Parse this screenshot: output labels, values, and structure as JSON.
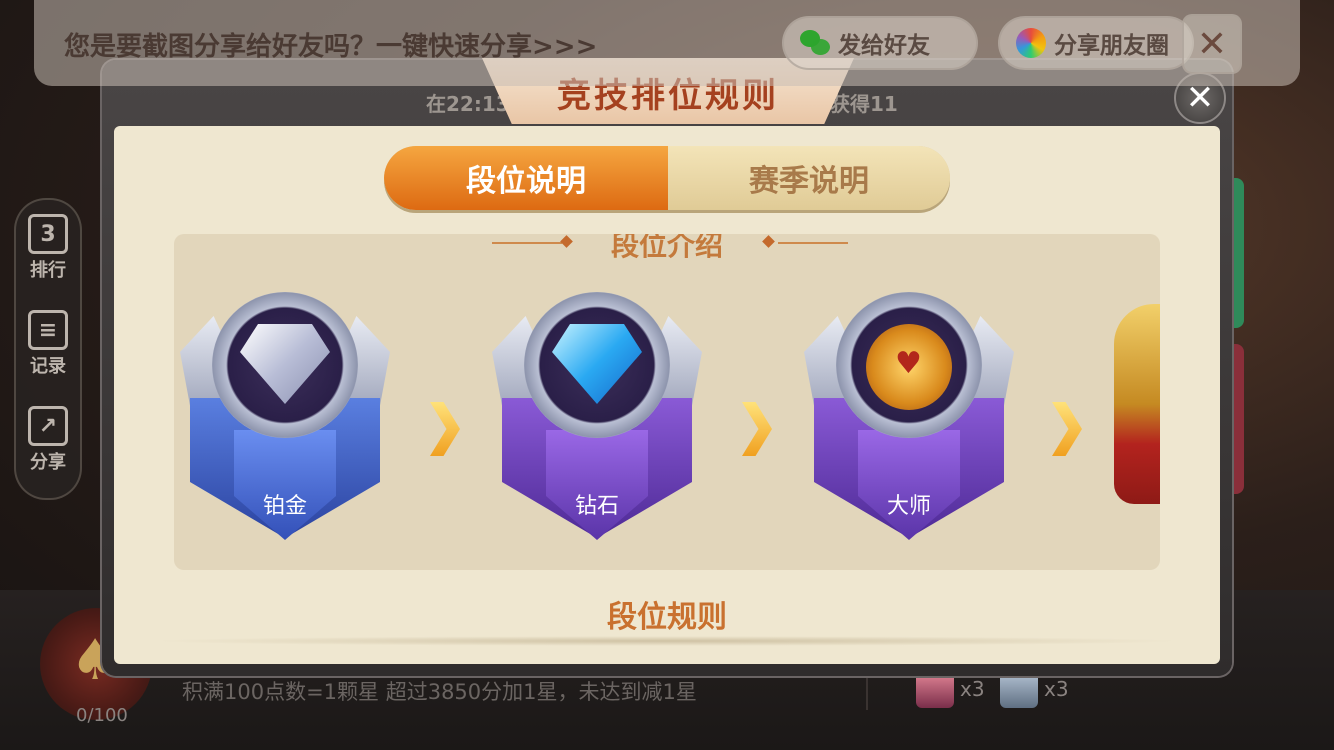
{
  "share_bar": {
    "prompt": "您是要截图分享给好友吗？一键快速分享>>>",
    "send_friend_label": "发给好友",
    "moments_label": "分享朋友圈",
    "close_glyph": "✕"
  },
  "side_menu": {
    "items": [
      {
        "label": "排行",
        "icon": "ranking-icon",
        "glyph": "3"
      },
      {
        "label": "记录",
        "icon": "records-icon",
        "glyph": "≡"
      },
      {
        "label": "分享",
        "icon": "share-icon",
        "glyph": "↗"
      }
    ]
  },
  "background": {
    "time_text": "在22:13",
    "reward_text": "获得11",
    "rule_text": "积满100点数=1颗星      超过3850分加1星，未达到减1星",
    "progress": "0/100",
    "items": [
      {
        "icon": "avatar-card-icon",
        "count": "x3"
      },
      {
        "icon": "ticket-icon",
        "count": "x3"
      }
    ]
  },
  "dialog": {
    "title": "竞技排位规则",
    "close_glyph": "✕",
    "tabs": [
      {
        "label": "段位说明",
        "active": true
      },
      {
        "label": "赛季说明",
        "active": false
      }
    ],
    "section_title": "段位介绍",
    "ranks": [
      {
        "name": "铂金",
        "shield_color": "#3e5fc2",
        "gem_color": "#d9dbe9"
      },
      {
        "name": "钻石",
        "shield_color": "#6a3fb0",
        "gem_color": "#2aa9f2"
      },
      {
        "name": "大师",
        "shield_color": "#6a3fb0",
        "gem_color": "#e0a53a"
      }
    ],
    "next_rank_partial_color": "#c58a22",
    "rules_title": "段位规则"
  },
  "colors": {
    "accent_orange": "#dd6a12",
    "title_red": "#a5411f",
    "panel_cream": "#efe7d0"
  }
}
